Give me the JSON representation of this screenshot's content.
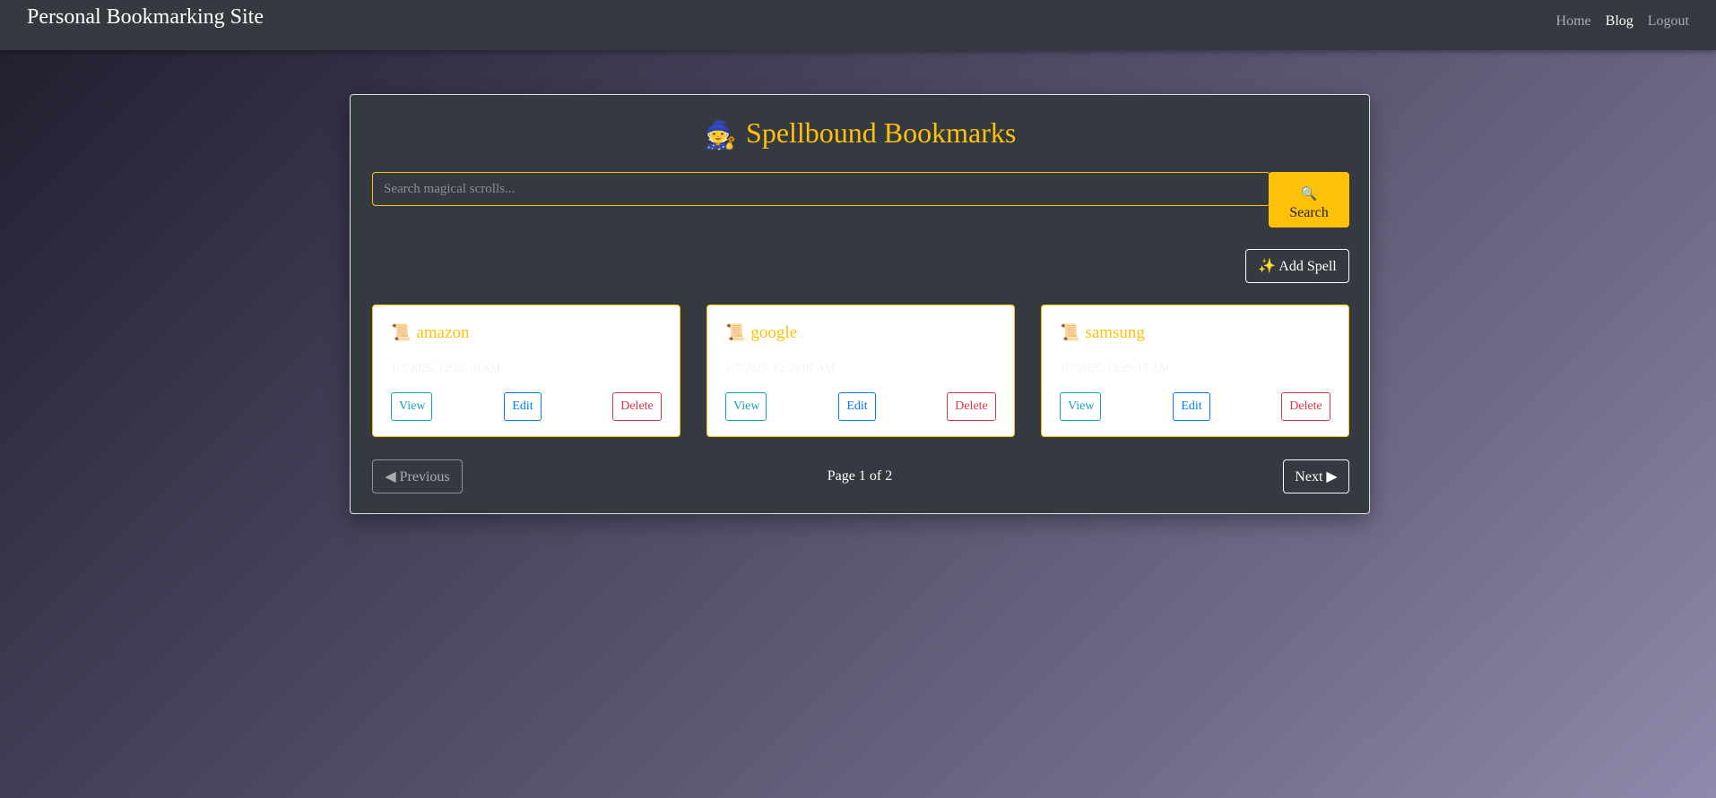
{
  "navbar": {
    "brand": "Personal Bookmarking Site",
    "links": [
      {
        "label": "Home",
        "active": false
      },
      {
        "label": "Blog",
        "active": true
      },
      {
        "label": "Logout",
        "active": false
      }
    ]
  },
  "main": {
    "title_icon": "🧙",
    "title": "Spellbound Bookmarks",
    "search": {
      "placeholder": "Search magical scrolls...",
      "value": "",
      "button_icon": "🔍",
      "button_label": "Search"
    },
    "add_button_label": "✨ Add Spell",
    "bookmarks": [
      {
        "icon": "📜",
        "title": "amazon",
        "date": "1/7/2025, 12:28:18 AM",
        "view": "View",
        "edit": "Edit",
        "delete": "Delete"
      },
      {
        "icon": "📜",
        "title": "google",
        "date": "1/7/2025, 12:28:07 AM",
        "view": "View",
        "edit": "Edit",
        "delete": "Delete"
      },
      {
        "icon": "📜",
        "title": "samsung",
        "date": "1/7/2025, 12:28:17 AM",
        "view": "View",
        "edit": "Edit",
        "delete": "Delete"
      }
    ],
    "pagination": {
      "previous": "◀ Previous",
      "page_info": "Page 1 of 2",
      "next": "Next ▶"
    }
  },
  "colors": {
    "accent": "#ffc107",
    "panel": "#343a40",
    "view": "#17a2b8",
    "edit": "#007bff",
    "delete": "#dc3545"
  }
}
